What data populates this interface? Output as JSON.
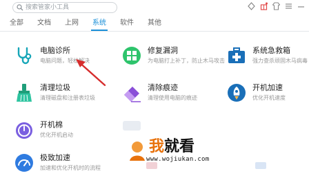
{
  "search": {
    "placeholder": "搜索管家小工具"
  },
  "tabs": [
    {
      "label": "全部",
      "active": false
    },
    {
      "label": "文档",
      "active": false
    },
    {
      "label": "上网",
      "active": false
    },
    {
      "label": "系统",
      "active": true
    },
    {
      "label": "软件",
      "active": false
    },
    {
      "label": "其他",
      "active": false
    }
  ],
  "accent_color": "#1a8fd8",
  "tools": [
    {
      "name": "电脑诊所",
      "desc": "电脑问题，轻松解决",
      "icon": "stethoscope-icon"
    },
    {
      "name": "修复漏洞",
      "desc": "为电脑打上补丁，防止木马攻击",
      "icon": "windows-shield-icon"
    },
    {
      "name": "系统急救箱",
      "desc": "强力查杀顽固木马病毒",
      "icon": "first-aid-kit-icon"
    },
    {
      "name": "清理垃圾",
      "desc": "清理磁盘和注册表垃圾",
      "icon": "broom-icon"
    },
    {
      "name": "清除痕迹",
      "desc": "清理使用电脑的痕迹",
      "icon": "eraser-icon"
    },
    {
      "name": "开机加速",
      "desc": "优化开机速度",
      "icon": "rocket-icon"
    },
    {
      "name": "开机棉",
      "desc": "优化开机启动",
      "icon": "power-clock-icon"
    },
    {
      "name": "极致加速",
      "desc": "加速和优化开机时的流程",
      "icon": "speedometer-icon"
    }
  ],
  "watermark": {
    "text1": "我",
    "text2": "就看",
    "url": "www.wojiukan.com"
  }
}
